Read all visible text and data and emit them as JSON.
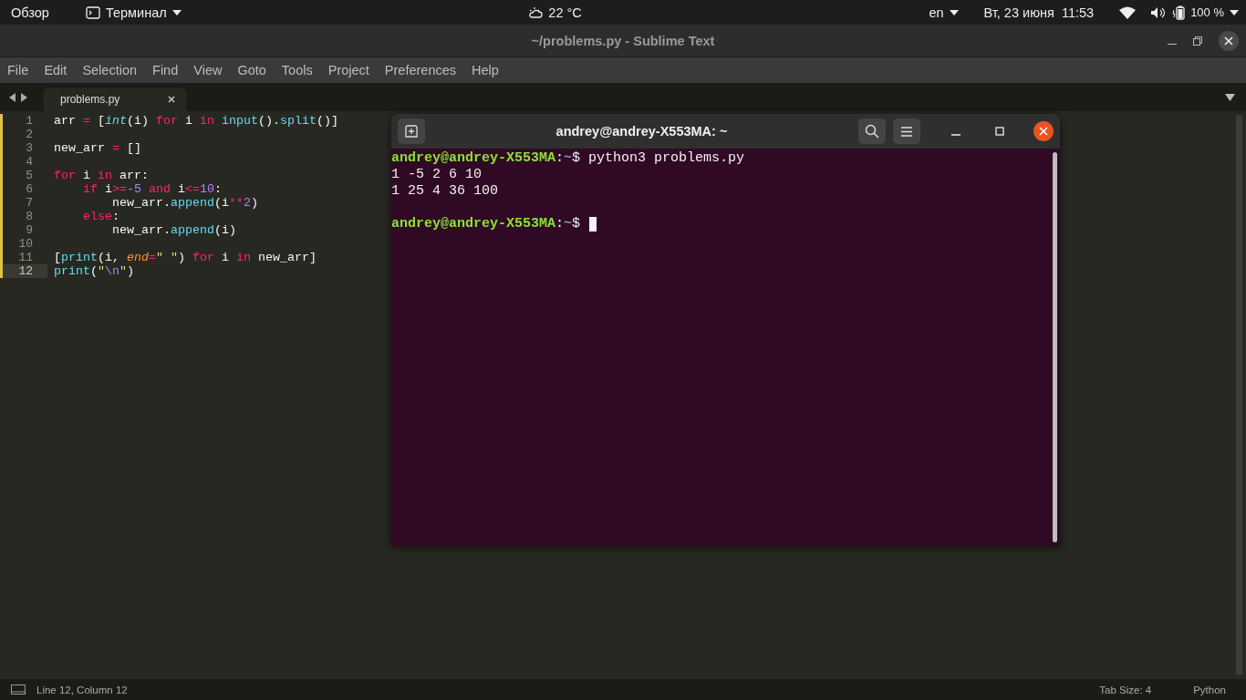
{
  "top_bar": {
    "activities": "Обзор",
    "app_menu": "Терминал",
    "weather": "22 °C",
    "keyboard": "en",
    "datetime": "Вт, 23 июня  11:53",
    "battery": "100 %"
  },
  "editor": {
    "title": "~/problems.py - Sublime Text",
    "menu": [
      "File",
      "Edit",
      "Selection",
      "Find",
      "View",
      "Goto",
      "Tools",
      "Project",
      "Preferences",
      "Help"
    ],
    "tabs": [
      {
        "label": "problems.py",
        "selected": true
      }
    ],
    "lines": [
      {
        "number": "1",
        "current": false,
        "tokens": [
          {
            "kind": "plain",
            "text": "arr "
          },
          {
            "kind": "op",
            "text": "="
          },
          {
            "kind": "plain",
            "text": " ["
          },
          {
            "kind": "type",
            "text": "int"
          },
          {
            "kind": "plain",
            "text": "(i) "
          },
          {
            "kind": "keyword",
            "text": "for"
          },
          {
            "kind": "plain",
            "text": " i "
          },
          {
            "kind": "keyword",
            "text": "in"
          },
          {
            "kind": "func",
            "text": " input"
          },
          {
            "kind": "plain",
            "text": "()."
          },
          {
            "kind": "func",
            "text": "split"
          },
          {
            "kind": "plain",
            "text": "()]"
          }
        ]
      },
      {
        "number": "2",
        "current": false
      },
      {
        "number": "3",
        "current": false,
        "tokens": [
          {
            "kind": "plain",
            "text": "new_arr "
          },
          {
            "kind": "op",
            "text": "="
          },
          {
            "kind": "plain",
            "text": " []"
          }
        ]
      },
      {
        "number": "4",
        "current": false
      },
      {
        "number": "5",
        "current": false,
        "tokens": [
          {
            "kind": "keyword",
            "text": "for"
          },
          {
            "kind": "plain",
            "text": " i "
          },
          {
            "kind": "keyword",
            "text": "in"
          },
          {
            "kind": "plain",
            "text": " arr:"
          }
        ],
        "children": [
          {
            "number": "6",
            "current": false,
            "tokens": [
              {
                "kind": "keyword",
                "text": "if"
              },
              {
                "kind": "plain",
                "text": " i"
              },
              {
                "kind": "op",
                "text": ">="
              },
              {
                "kind": "number",
                "text": "-5"
              },
              {
                "kind": "keyword",
                "text": " and"
              },
              {
                "kind": "plain",
                "text": " i"
              },
              {
                "kind": "op",
                "text": "<="
              },
              {
                "kind": "number",
                "text": "10"
              },
              {
                "kind": "plain",
                "text": ":"
              }
            ],
            "children": [
              {
                "number": "7",
                "current": false,
                "tokens": [
                  {
                    "kind": "plain",
                    "text": "new_arr."
                  },
                  {
                    "kind": "func",
                    "text": "append"
                  },
                  {
                    "kind": "plain",
                    "text": "(i"
                  },
                  {
                    "kind": "op",
                    "text": "**"
                  },
                  {
                    "kind": "number",
                    "text": "2"
                  },
                  {
                    "kind": "plain",
                    "text": ")"
                  }
                ]
              }
            ]
          },
          {
            "number": "8",
            "current": false,
            "tokens": [
              {
                "kind": "keyword",
                "text": "else"
              },
              {
                "kind": "plain",
                "text": ":"
              }
            ],
            "children": [
              {
                "number": "9",
                "current": false,
                "tokens": [
                  {
                    "kind": "plain",
                    "text": "new_arr."
                  },
                  {
                    "kind": "func",
                    "text": "append"
                  },
                  {
                    "kind": "plain",
                    "text": "(i)"
                  }
                ]
              }
            ]
          }
        ]
      },
      {
        "number": "10",
        "current": false
      },
      {
        "number": "11",
        "current": false,
        "tokens": [
          {
            "kind": "plain",
            "text": "["
          },
          {
            "kind": "func",
            "text": "print"
          },
          {
            "kind": "plain",
            "text": "(i, "
          },
          {
            "kind": "param",
            "text": "end"
          },
          {
            "kind": "op",
            "text": "="
          },
          {
            "kind": "string",
            "text": "\" \""
          },
          {
            "kind": "plain",
            "text": ") "
          },
          {
            "kind": "keyword",
            "text": "for"
          },
          {
            "kind": "plain",
            "text": " i "
          },
          {
            "kind": "keyword",
            "text": "in"
          },
          {
            "kind": "plain",
            "text": " new_arr]"
          }
        ]
      },
      {
        "number": "12",
        "current": true,
        "tokens": [
          {
            "kind": "func",
            "text": "print"
          },
          {
            "kind": "plain",
            "text": "("
          },
          {
            "kind": "string",
            "text": "\""
          },
          {
            "kind": "number",
            "text": "\\n"
          },
          {
            "kind": "string",
            "text": "\""
          },
          {
            "kind": "plain",
            "text": ")"
          }
        ]
      }
    ],
    "status_bar": {
      "position": "Line 12, Column 12",
      "tab_size": "Tab Size: 4",
      "syntax": "Python"
    }
  },
  "terminal": {
    "title": "andrey@andrey-X553MA: ~",
    "lines": [
      {
        "kind": "text",
        "segments": [
          {
            "kind": "user",
            "text": "andrey@andrey-X553MA"
          },
          {
            "kind": "plain",
            "text": ":"
          },
          {
            "kind": "path",
            "text": "~"
          },
          {
            "kind": "plain",
            "text": "$ python3 problems.py"
          }
        ]
      },
      {
        "kind": "text",
        "segments": [
          {
            "kind": "plain",
            "text": "1 -5 2 6 10"
          }
        ]
      },
      {
        "kind": "text",
        "segments": [
          {
            "kind": "plain",
            "text": "1 25 4 36 100"
          }
        ]
      },
      {
        "kind": "blank"
      },
      {
        "kind": "text",
        "segments": [
          {
            "kind": "user",
            "text": "andrey@andrey-X553MA"
          },
          {
            "kind": "plain",
            "text": ":"
          },
          {
            "kind": "path",
            "text": "~"
          },
          {
            "kind": "plain",
            "text": "$ "
          }
        ],
        "cursor": true
      }
    ]
  }
}
